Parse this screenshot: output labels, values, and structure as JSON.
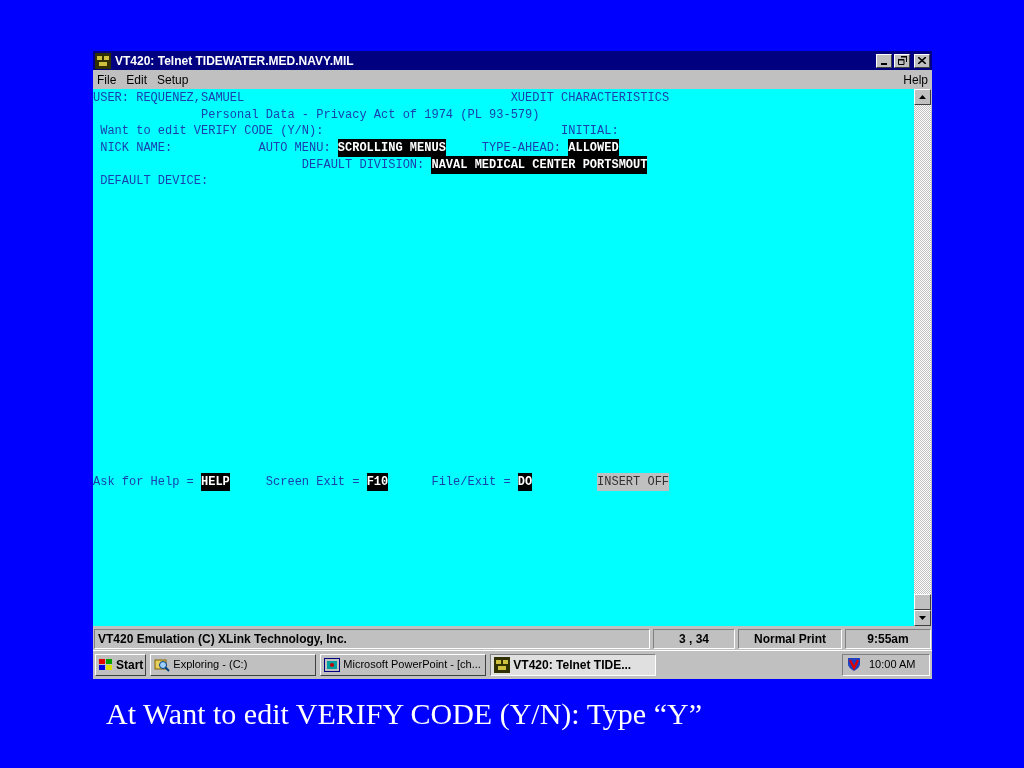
{
  "window": {
    "title": "VT420: Telnet TIDEWATER.MED.NAVY.MIL"
  },
  "menu": {
    "left": [
      "File",
      "Edit",
      "Setup"
    ],
    "right": [
      "Help"
    ]
  },
  "terminal": {
    "lines": [
      [
        {
          "text": "USER: REQUENEZ,SAMUEL",
          "kind": "normal"
        },
        {
          "text": "XUEDIT CHARACTERISTICS",
          "kind": "normal"
        }
      ],
      [
        {
          "text": "Personal Data - Privacy Act of 1974 (PL 93-579)",
          "kind": "normal"
        }
      ],
      [
        {
          "text": "Want to edit VERIFY CODE (Y/N):",
          "kind": "normal"
        },
        {
          "text": "INITIAL:",
          "kind": "normal"
        }
      ],
      [
        {
          "text": "NICK NAME:",
          "kind": "normal"
        },
        {
          "text": "AUTO MENU:",
          "kind": "normal"
        },
        {
          "text": "SCROLLING MENUS",
          "kind": "inverse"
        },
        {
          "text": "TYPE-AHEAD:",
          "kind": "normal"
        },
        {
          "text": "ALLOWED",
          "kind": "inverse"
        }
      ],
      [
        {
          "text": "DEFAULT DIVISION:",
          "kind": "normal"
        },
        {
          "text": "NAVAL MEDICAL CENTER PORTSMOUT",
          "kind": "inverse"
        }
      ],
      [
        {
          "text": "DEFAULT DEVICE:",
          "kind": "normal"
        }
      ]
    ],
    "footer": [
      {
        "text": "Ask for Help =",
        "kind": "normal"
      },
      {
        "text": "HELP",
        "kind": "inverse"
      },
      {
        "text": "Screen Exit =",
        "kind": "normal"
      },
      {
        "text": "F10",
        "kind": "inverse"
      },
      {
        "text": "File/Exit =",
        "kind": "normal"
      },
      {
        "text": "DO",
        "kind": "inverse"
      },
      {
        "text": "INSERT OFF",
        "kind": "dim"
      }
    ]
  },
  "status_bar": [
    "VT420 Emulation (C) XLink Technology, Inc.",
    "3 , 34",
    "Normal Print",
    "9:55am"
  ],
  "taskbar": {
    "start": "Start",
    "tasks": [
      {
        "label": "Exploring - (C:)",
        "kind": "explorer",
        "selected": false
      },
      {
        "label": "Microsoft PowerPoint - [ch...",
        "kind": "powerpoint",
        "selected": false
      },
      {
        "label": "VT420: Telnet TIDE...",
        "kind": "terminal",
        "selected": true
      }
    ],
    "clock": "10:00 AM"
  },
  "caption": "At Want to edit VERIFY CODE (Y/N): Type “Y”"
}
